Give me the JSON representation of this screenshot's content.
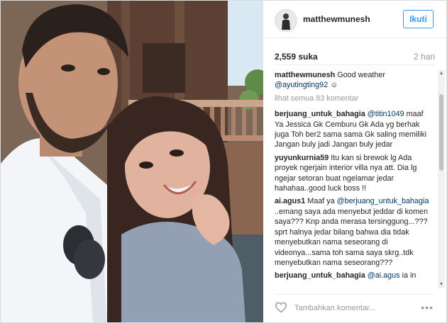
{
  "header": {
    "username": "matthewmunesh",
    "follow_label": "Ikuti"
  },
  "meta": {
    "likes": "2,559 suka",
    "time": "2 hari"
  },
  "caption": {
    "user": "matthewmunesh",
    "text": " Good weather ",
    "mention": "@ayutingting92",
    "tail": " ☺"
  },
  "view_all": "lihat semua 83 komentar",
  "comments": [
    {
      "user": "berjuang_untuk_bahagia",
      "mention": "@titin1049",
      "text": " maaf Ya Jessica Gk Cemburu Gk Ada yg berhak juga Toh ber2 sama sama Gk saling memiliki Jangan buly jadi Jangan buly jedar"
    },
    {
      "user": "yuyunkurnia59",
      "mention": "",
      "text": " Itu kan si brewok lg Ada proyek ngerjain interior villa nya att. Dia lg ngejar setoran buat ngelamar jedar hahahaa..good luck boss !!"
    },
    {
      "user": "ai.agus1",
      "mention": "@berjuang_untuk_bahagia",
      "pre": " Maaf ya ",
      "text": " ..emang saya ada menyebut jeddar di komen saya??? Knp anda merasa tersinggung...??? sprt halnya jedar bilang bahwa dia tidak menyebutkan nama seseorang di videonya...sama toh sama saya skrg..tdk menyebutkan nama seseorang???"
    },
    {
      "user": "berjuang_untuk_bahagia",
      "mention": "@ai.agus",
      "text": " ia in"
    }
  ],
  "footer": {
    "add_comment_placeholder": "Tambahkan komentar...",
    "more": "•••"
  },
  "icons": {
    "heart": "heart-outline-icon",
    "more": "more-options-icon"
  },
  "colors": {
    "link": "#003569",
    "accent": "#3897f0",
    "muted": "#999999"
  }
}
